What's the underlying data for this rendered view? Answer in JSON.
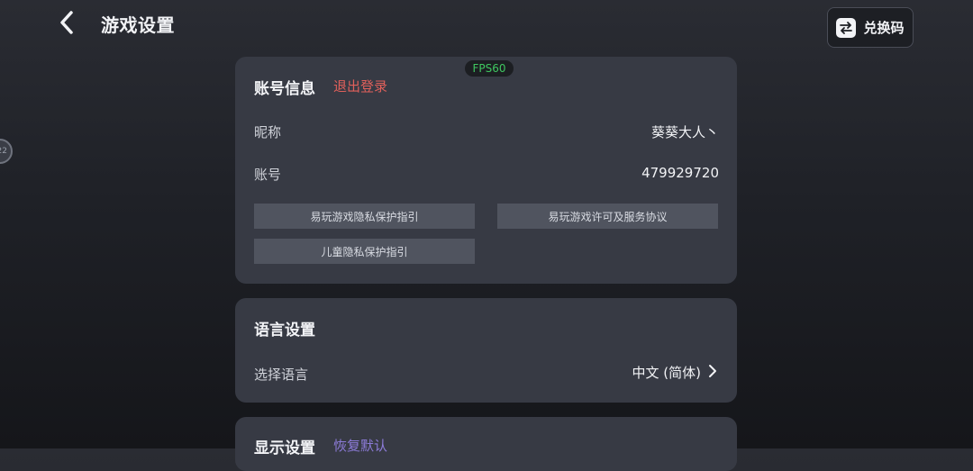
{
  "header": {
    "title": "游戏设置",
    "redeem_label": "兑换码"
  },
  "side_handle": {
    "text": "22"
  },
  "fps_badge": "FPS60",
  "account": {
    "title": "账号信息",
    "logout_label": "退出登录",
    "nickname_label": "昵称",
    "nickname_value": "葵葵大人丶",
    "account_label": "账号",
    "account_value": "479929720",
    "links": [
      "易玩游戏隐私保护指引",
      "易玩游戏许可及服务协议",
      "儿童隐私保护指引"
    ]
  },
  "language": {
    "title": "语言设置",
    "select_label": "选择语言",
    "selected_value": "中文 (简体)"
  },
  "display": {
    "title": "显示设置",
    "reset_label": "恢复默认"
  },
  "colors": {
    "logout": "#e0605b",
    "reset": "#8c7bd8",
    "fps": "#3fc760"
  },
  "icons": {
    "back": "chevron-left-icon",
    "redeem": "swap-arrows-icon",
    "language_chevron": "chevron-right-icon"
  }
}
